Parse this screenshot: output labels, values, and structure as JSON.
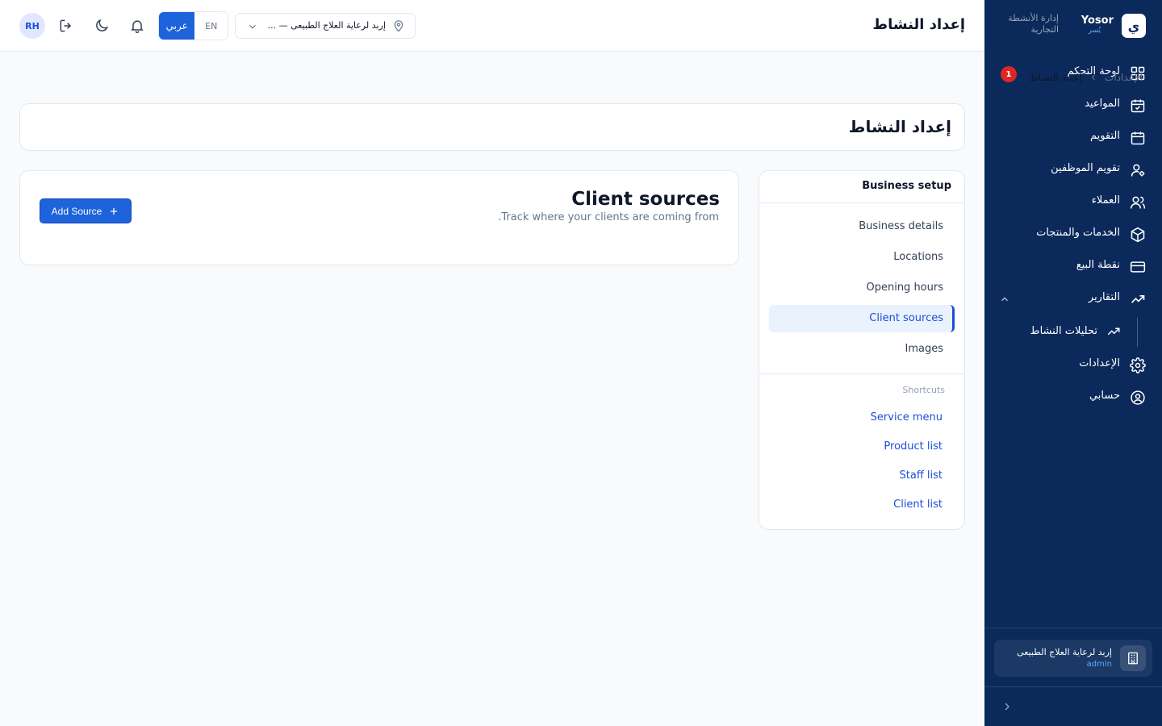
{
  "sidebar": {
    "brand_name": "Yosor",
    "brand_name_ar": "يُسر",
    "brand_logo_char": "ي",
    "brand_tagline": "إدارة الأنشطة التجارية",
    "items": [
      {
        "label": "لوحة التحكم",
        "icon": "dashboard-grid-icon",
        "badge": "1"
      },
      {
        "label": "المواعيد",
        "icon": "calendar-check-icon"
      },
      {
        "label": "التقويم",
        "icon": "calendar-icon"
      },
      {
        "label": "تقويم الموظفين",
        "icon": "user-gear-icon"
      },
      {
        "label": "العملاء",
        "icon": "users-icon"
      },
      {
        "label": "الخدمات والمنتجات",
        "icon": "box-icon"
      },
      {
        "label": "نقطة البيع",
        "icon": "credit-card-icon"
      },
      {
        "label": "التقارير",
        "icon": "trending-up-icon",
        "expanded": true
      },
      {
        "label": "الإعدادات",
        "icon": "gear-icon"
      },
      {
        "label": "حسابي",
        "icon": "user-circle-icon"
      }
    ],
    "reports_sub": {
      "label": "تحليلات النشاط",
      "icon": "trending-up-icon"
    },
    "org": {
      "name": "إربد لرعاية العلاج الطبيعى",
      "role": "admin"
    }
  },
  "topbar": {
    "title": "إعداد النشاط",
    "avatar_initials": "RH",
    "lang_ar": "عربي",
    "lang_en": "EN",
    "location_value": "إربد لرعاية العلاج الطبيعى — ..."
  },
  "breadcrumb": {
    "root": "الإعدادات",
    "current": "إعداد النشاط"
  },
  "header": {
    "title": "إعداد النشاط"
  },
  "settings_menu": {
    "title": "Business setup",
    "items": [
      "Business details",
      "Locations",
      "Opening hours",
      "Client sources",
      "Images"
    ],
    "active": "Client sources",
    "shortcuts_label": "Shortcuts",
    "shortcuts": [
      "Service menu",
      "Product list",
      "Staff list",
      "Client list"
    ]
  },
  "content": {
    "title": "Client sources",
    "subtitle": ".Track where your clients are coming from",
    "add_button": "Add Source"
  },
  "colors": {
    "sidebar_bg": "#0b2a5b",
    "accent": "#1d63dc",
    "badge": "#dc2626",
    "link": "#1d4ed8"
  }
}
